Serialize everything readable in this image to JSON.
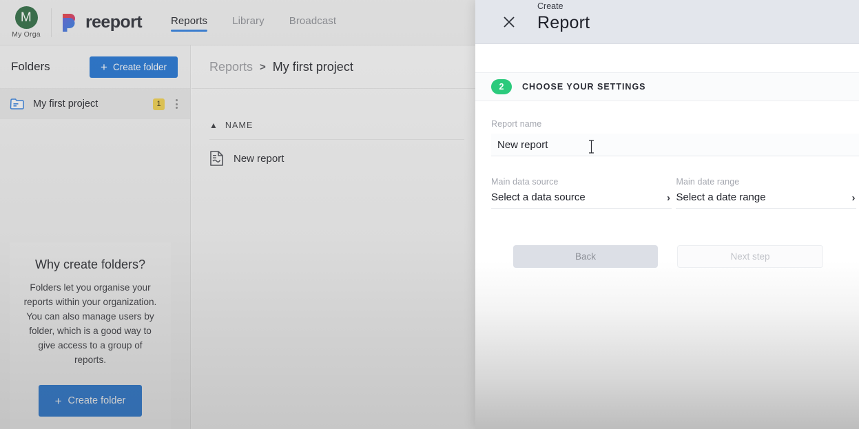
{
  "topbar": {
    "org": {
      "initial": "M",
      "name": "My Orga"
    },
    "brand": {
      "name": "reeport",
      "mark_icon": "reeport-logo-icon"
    },
    "nav": [
      {
        "label": "Reports",
        "active": true
      },
      {
        "label": "Library",
        "active": false
      },
      {
        "label": "Broadcast",
        "active": false
      }
    ]
  },
  "sidebar": {
    "title": "Folders",
    "create_folder_label": "Create folder",
    "plus_icon": "plus-icon",
    "folders": [
      {
        "label": "My first project",
        "badge": "1",
        "folder_icon": "folder-icon",
        "menu_icon": "kebab-menu-icon"
      }
    ],
    "info_card": {
      "title": "Why create folders?",
      "text": "Folders let you organise your reports within your organization. You can also manage users by folder, which is a good way to give access to a group of reports.",
      "button_label": "Create folder"
    }
  },
  "content": {
    "breadcrumb": {
      "root": "Reports",
      "separator": ">",
      "current": "My first project"
    },
    "list": {
      "sort_icon": "chevron-up-icon",
      "column_header": "NAME",
      "rows": [
        {
          "label": "New report",
          "icon": "report-document-icon"
        }
      ]
    }
  },
  "modal": {
    "close_icon": "close-icon",
    "kicker": "Create",
    "title": "Report",
    "step": {
      "number": "2",
      "label": "CHOOSE YOUR SETTINGS"
    },
    "report_name": {
      "label": "Report name",
      "value": "New report",
      "placeholder": "Report name"
    },
    "data_source": {
      "label": "Main data source",
      "value": "Select a data source",
      "chevron": "›",
      "chevron_icon": "chevron-right-icon"
    },
    "date_range": {
      "label": "Main date range",
      "value": "Select a date range",
      "chevron": "›",
      "chevron_icon": "chevron-right-icon"
    },
    "back_label": "Back",
    "next_label": "Next step"
  },
  "colors": {
    "brand_blue": "#1e73d4",
    "step_green": "#2bca7c",
    "badge_yellow": "#f3d24b",
    "org_green": "#2e6b42",
    "nav_underline": "#2f7fe0"
  }
}
